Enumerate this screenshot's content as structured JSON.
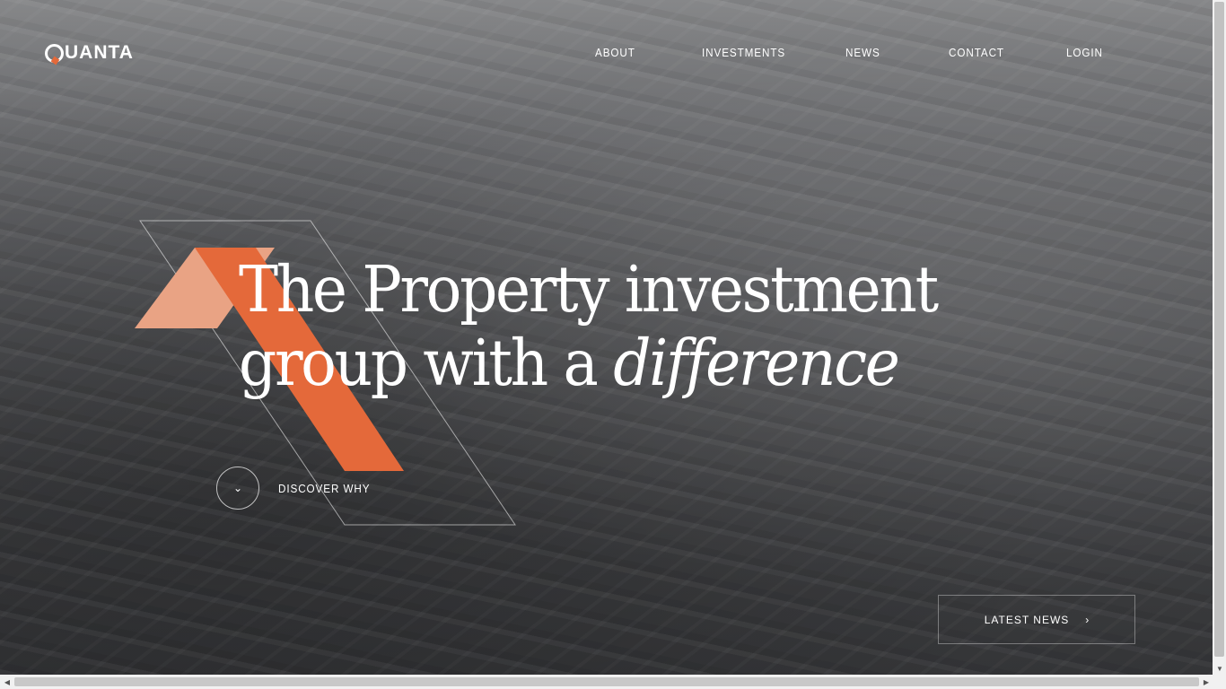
{
  "brand": {
    "logo_text": "UANTA",
    "accent_color": "#E4693A",
    "accent_light_color": "#E9A384"
  },
  "nav": {
    "items": [
      {
        "label": "ABOUT"
      },
      {
        "label": "INVESTMENTS"
      },
      {
        "label": "NEWS"
      },
      {
        "label": "CONTACT"
      },
      {
        "label": "LOGIN"
      }
    ]
  },
  "hero": {
    "headline_line1": "The Property investment",
    "headline_line2_prefix": "group with a ",
    "headline_line2_emphasis": "difference",
    "discover_label": "DISCOVER WHY",
    "discover_icon": "chevron-down-icon",
    "latest_news_label": "LATEST NEWS",
    "latest_news_icon": "chevron-right-icon"
  }
}
